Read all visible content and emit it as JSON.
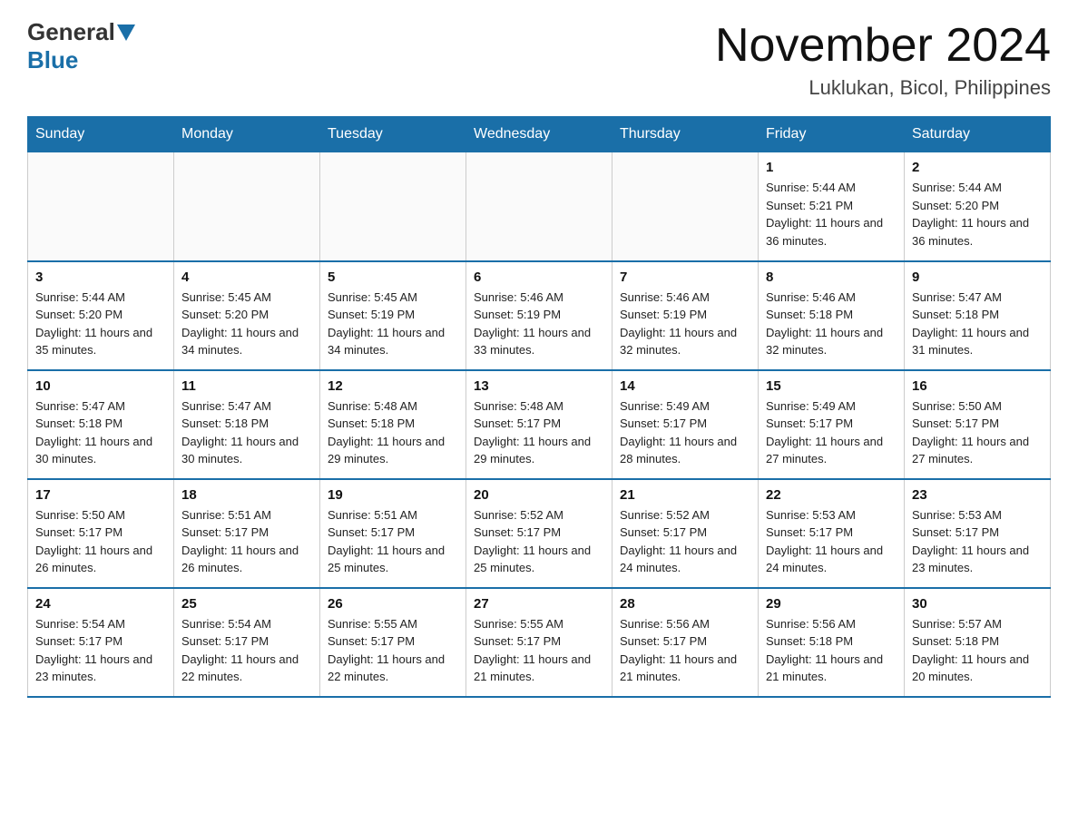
{
  "header": {
    "logo_general": "General",
    "logo_blue": "Blue",
    "month_title": "November 2024",
    "location": "Luklukan, Bicol, Philippines"
  },
  "days_of_week": [
    "Sunday",
    "Monday",
    "Tuesday",
    "Wednesday",
    "Thursday",
    "Friday",
    "Saturday"
  ],
  "weeks": [
    [
      {
        "day": "",
        "info": ""
      },
      {
        "day": "",
        "info": ""
      },
      {
        "day": "",
        "info": ""
      },
      {
        "day": "",
        "info": ""
      },
      {
        "day": "",
        "info": ""
      },
      {
        "day": "1",
        "info": "Sunrise: 5:44 AM\nSunset: 5:21 PM\nDaylight: 11 hours and 36 minutes."
      },
      {
        "day": "2",
        "info": "Sunrise: 5:44 AM\nSunset: 5:20 PM\nDaylight: 11 hours and 36 minutes."
      }
    ],
    [
      {
        "day": "3",
        "info": "Sunrise: 5:44 AM\nSunset: 5:20 PM\nDaylight: 11 hours and 35 minutes."
      },
      {
        "day": "4",
        "info": "Sunrise: 5:45 AM\nSunset: 5:20 PM\nDaylight: 11 hours and 34 minutes."
      },
      {
        "day": "5",
        "info": "Sunrise: 5:45 AM\nSunset: 5:19 PM\nDaylight: 11 hours and 34 minutes."
      },
      {
        "day": "6",
        "info": "Sunrise: 5:46 AM\nSunset: 5:19 PM\nDaylight: 11 hours and 33 minutes."
      },
      {
        "day": "7",
        "info": "Sunrise: 5:46 AM\nSunset: 5:19 PM\nDaylight: 11 hours and 32 minutes."
      },
      {
        "day": "8",
        "info": "Sunrise: 5:46 AM\nSunset: 5:18 PM\nDaylight: 11 hours and 32 minutes."
      },
      {
        "day": "9",
        "info": "Sunrise: 5:47 AM\nSunset: 5:18 PM\nDaylight: 11 hours and 31 minutes."
      }
    ],
    [
      {
        "day": "10",
        "info": "Sunrise: 5:47 AM\nSunset: 5:18 PM\nDaylight: 11 hours and 30 minutes."
      },
      {
        "day": "11",
        "info": "Sunrise: 5:47 AM\nSunset: 5:18 PM\nDaylight: 11 hours and 30 minutes."
      },
      {
        "day": "12",
        "info": "Sunrise: 5:48 AM\nSunset: 5:18 PM\nDaylight: 11 hours and 29 minutes."
      },
      {
        "day": "13",
        "info": "Sunrise: 5:48 AM\nSunset: 5:17 PM\nDaylight: 11 hours and 29 minutes."
      },
      {
        "day": "14",
        "info": "Sunrise: 5:49 AM\nSunset: 5:17 PM\nDaylight: 11 hours and 28 minutes."
      },
      {
        "day": "15",
        "info": "Sunrise: 5:49 AM\nSunset: 5:17 PM\nDaylight: 11 hours and 27 minutes."
      },
      {
        "day": "16",
        "info": "Sunrise: 5:50 AM\nSunset: 5:17 PM\nDaylight: 11 hours and 27 minutes."
      }
    ],
    [
      {
        "day": "17",
        "info": "Sunrise: 5:50 AM\nSunset: 5:17 PM\nDaylight: 11 hours and 26 minutes."
      },
      {
        "day": "18",
        "info": "Sunrise: 5:51 AM\nSunset: 5:17 PM\nDaylight: 11 hours and 26 minutes."
      },
      {
        "day": "19",
        "info": "Sunrise: 5:51 AM\nSunset: 5:17 PM\nDaylight: 11 hours and 25 minutes."
      },
      {
        "day": "20",
        "info": "Sunrise: 5:52 AM\nSunset: 5:17 PM\nDaylight: 11 hours and 25 minutes."
      },
      {
        "day": "21",
        "info": "Sunrise: 5:52 AM\nSunset: 5:17 PM\nDaylight: 11 hours and 24 minutes."
      },
      {
        "day": "22",
        "info": "Sunrise: 5:53 AM\nSunset: 5:17 PM\nDaylight: 11 hours and 24 minutes."
      },
      {
        "day": "23",
        "info": "Sunrise: 5:53 AM\nSunset: 5:17 PM\nDaylight: 11 hours and 23 minutes."
      }
    ],
    [
      {
        "day": "24",
        "info": "Sunrise: 5:54 AM\nSunset: 5:17 PM\nDaylight: 11 hours and 23 minutes."
      },
      {
        "day": "25",
        "info": "Sunrise: 5:54 AM\nSunset: 5:17 PM\nDaylight: 11 hours and 22 minutes."
      },
      {
        "day": "26",
        "info": "Sunrise: 5:55 AM\nSunset: 5:17 PM\nDaylight: 11 hours and 22 minutes."
      },
      {
        "day": "27",
        "info": "Sunrise: 5:55 AM\nSunset: 5:17 PM\nDaylight: 11 hours and 21 minutes."
      },
      {
        "day": "28",
        "info": "Sunrise: 5:56 AM\nSunset: 5:17 PM\nDaylight: 11 hours and 21 minutes."
      },
      {
        "day": "29",
        "info": "Sunrise: 5:56 AM\nSunset: 5:18 PM\nDaylight: 11 hours and 21 minutes."
      },
      {
        "day": "30",
        "info": "Sunrise: 5:57 AM\nSunset: 5:18 PM\nDaylight: 11 hours and 20 minutes."
      }
    ]
  ]
}
